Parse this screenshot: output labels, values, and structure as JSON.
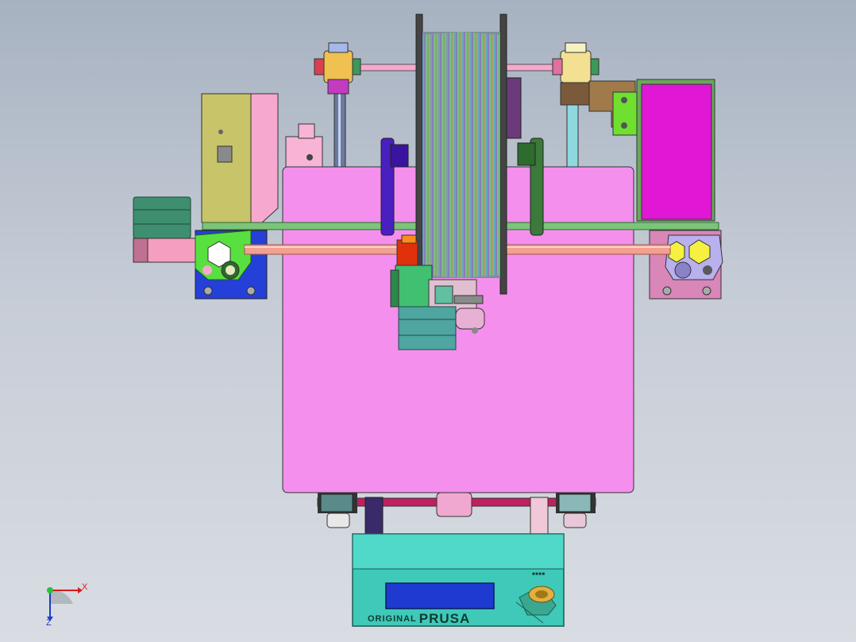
{
  "viewport": {
    "background_top": "#a7b2c1",
    "background_bottom": "#d9dde3"
  },
  "model": {
    "lcd_brand_small": "ORIGINAL",
    "lcd_brand_large": "PRUSA",
    "lcd_tiny_label": "■■■■",
    "colors": {
      "heatbed": "#f48fee",
      "lcd_housing": "#3ec9b8",
      "lcd_screen": "#1f3ad0",
      "right_box": "#e018d6",
      "frame_bar": "#7cc47a",
      "x_rod": "#f3a090",
      "left_bracket": "#58e040",
      "right_idler": "#b9b0ee",
      "motor": "#3e8f6f",
      "y_motor": "#4fa5a0",
      "left_box": "#c8c46a"
    }
  },
  "triad": {
    "x_label": "X",
    "z_label": "Z",
    "icon": "axis-triad-icon"
  }
}
